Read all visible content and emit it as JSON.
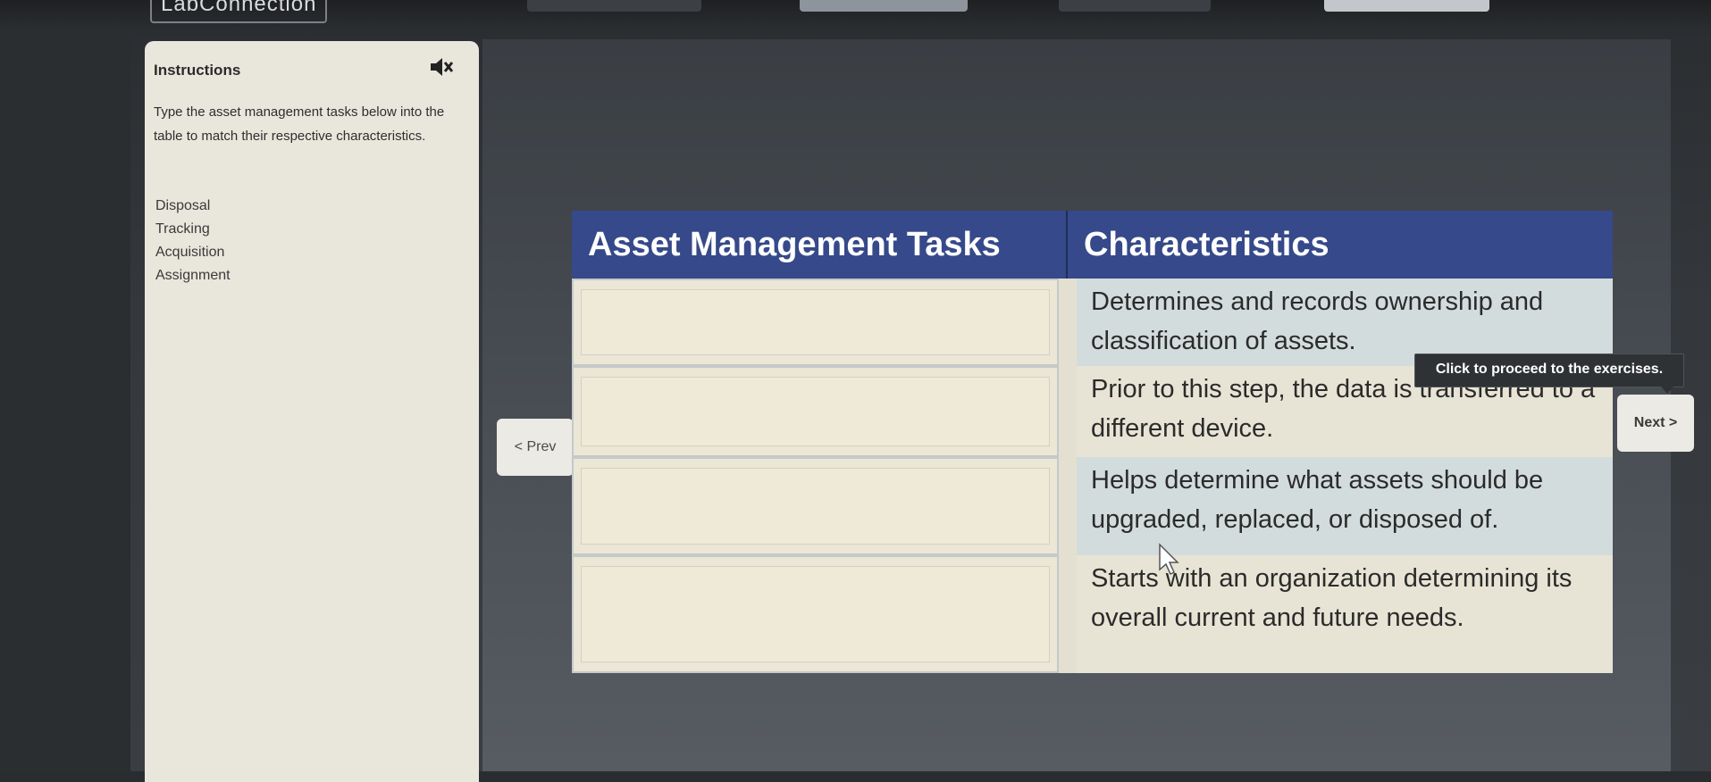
{
  "app": {
    "title": "LabConnection"
  },
  "colors": {
    "header_bg": "#36498a",
    "sidebar_bg": "#e9e7dc",
    "row_alt_bg": "#d3dcdc",
    "tooltip_bg": "#2f3235"
  },
  "sidebar": {
    "title": "Instructions",
    "mute_icon": "speaker-muted-icon",
    "instructions": "Type the asset management tasks below into the table to match their respective characteristics.",
    "tasks": [
      "Disposal",
      "Tracking",
      "Acquisition",
      "Assignment"
    ]
  },
  "table": {
    "headers": {
      "tasks": "Asset Management Tasks",
      "characteristics": "Characteristics"
    },
    "rows": [
      {
        "answer": "",
        "characteristic": "Determines and records ownership and classification of assets."
      },
      {
        "answer": "",
        "characteristic": "Prior to this step, the data is transferred to a different device."
      },
      {
        "answer": "",
        "characteristic": "Helps determine what assets should be upgraded, replaced, or disposed of."
      },
      {
        "answer": "",
        "characteristic": "Starts with an organization determining its overall current and future needs."
      }
    ]
  },
  "nav": {
    "prev_label": "< Prev",
    "next_label": "Next >"
  },
  "tooltip": {
    "text": "Click to proceed to the exercises."
  }
}
